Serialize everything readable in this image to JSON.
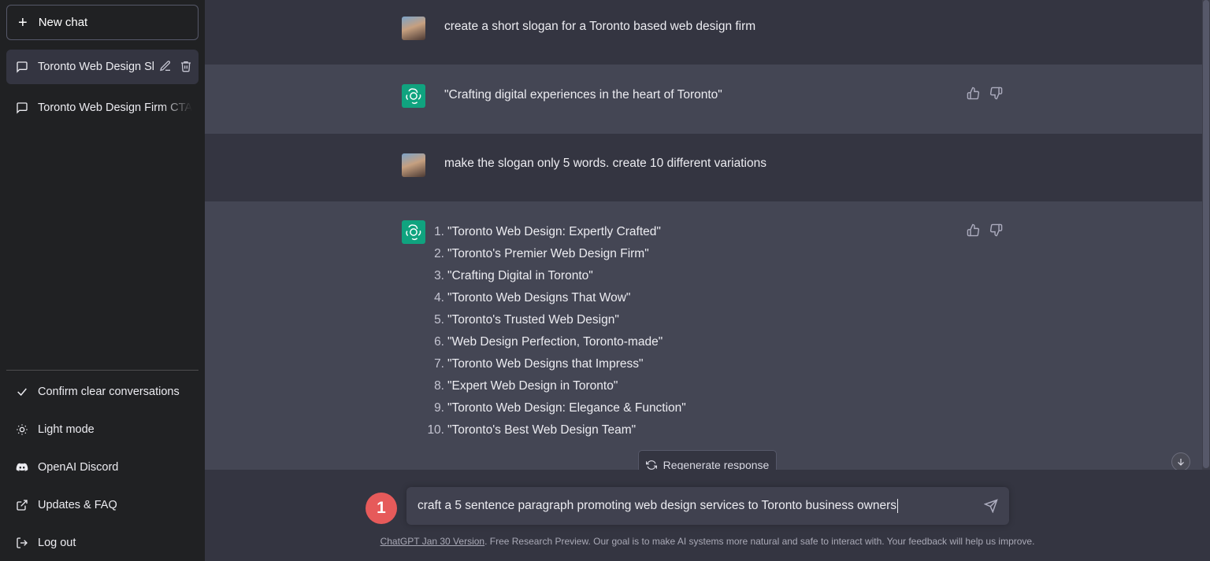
{
  "sidebar": {
    "new_chat": {
      "icon": "plus-icon",
      "label": "New chat"
    },
    "conversations": [
      {
        "label": "Toronto Web Design Sl",
        "active": true,
        "icon": "chat-bubble-icon"
      },
      {
        "label": "Toronto Web Design Firm CTA",
        "active": false,
        "icon": "chat-bubble-icon"
      }
    ],
    "menu": [
      {
        "icon": "check-icon",
        "label": "Confirm clear conversations"
      },
      {
        "icon": "sun-icon",
        "label": "Light mode"
      },
      {
        "icon": "discord-icon",
        "label": "OpenAI Discord"
      },
      {
        "icon": "external-link-icon",
        "label": "Updates & FAQ"
      },
      {
        "icon": "logout-icon",
        "label": "Log out"
      }
    ]
  },
  "chat": {
    "messages": [
      {
        "role": "user",
        "text": "create a short slogan for a Toronto based web design firm"
      },
      {
        "role": "assistant",
        "text": "\"Crafting digital experiences in the heart of Toronto\""
      },
      {
        "role": "user",
        "text": "make the slogan only 5 words. create 10 different variations"
      },
      {
        "role": "assistant",
        "list": [
          {
            "n": "1.",
            "t": "\"Toronto Web Design: Expertly Crafted\""
          },
          {
            "n": "2.",
            "t": "\"Toronto's Premier Web Design Firm\""
          },
          {
            "n": "3.",
            "t": "\"Crafting Digital in Toronto\""
          },
          {
            "n": "4.",
            "t": "\"Toronto Web Designs That Wow\""
          },
          {
            "n": "5.",
            "t": "\"Toronto's Trusted Web Design\""
          },
          {
            "n": "6.",
            "t": "\"Web Design Perfection, Toronto-made\""
          },
          {
            "n": "7.",
            "t": "\"Toronto Web Designs that Impress\""
          },
          {
            "n": "8.",
            "t": "\"Expert Web Design in Toronto\""
          },
          {
            "n": "9.",
            "t": "\"Toronto Web Design: Elegance & Function\""
          },
          {
            "n": "10.",
            "t": "\"Toronto's Best Web Design Team\""
          }
        ]
      }
    ],
    "regenerate_label": "Regenerate response"
  },
  "composer": {
    "value": "craft a 5 sentence paragraph promoting web design services to Toronto business owners",
    "step_badge": "1"
  },
  "footer": {
    "version_link": "ChatGPT Jan 30 Version",
    "text": ". Free Research Preview. Our goal is to make AI systems more natural and safe to interact with. Your feedback will help us improve."
  },
  "colors": {
    "sidebar_bg": "#202123",
    "user_row_bg": "#343541",
    "assistant_row_bg": "#444654",
    "accent": "#10a37f",
    "badge": "#e65a5a"
  }
}
